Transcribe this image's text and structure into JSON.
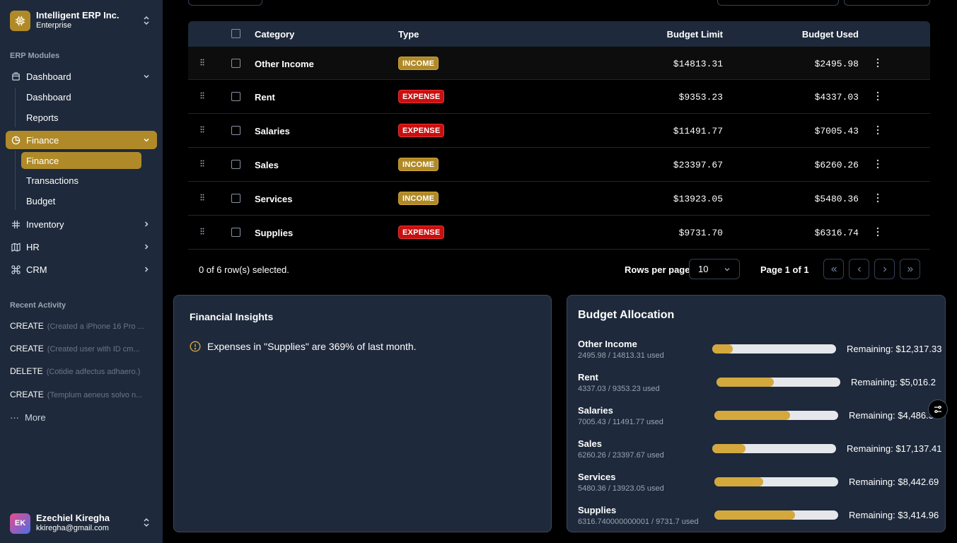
{
  "org": {
    "name": "Intelligent ERP Inc.",
    "plan": "Enterprise"
  },
  "sidebar": {
    "section_label": "ERP Modules",
    "dashboard": {
      "label": "Dashboard",
      "subitems": [
        "Dashboard",
        "Reports"
      ]
    },
    "finance": {
      "label": "Finance",
      "subitems": [
        "Finance",
        "Transactions",
        "Budget"
      ]
    },
    "inventory": {
      "label": "Inventory"
    },
    "hr": {
      "label": "HR"
    },
    "crm": {
      "label": "CRM"
    },
    "recent_label": "Recent Activity",
    "recent": [
      {
        "action": "CREATE",
        "desc": "(Created a iPhone 16 Pro ..."
      },
      {
        "action": "CREATE",
        "desc": "(Created user with ID cm..."
      },
      {
        "action": "DELETE",
        "desc": "(Cotidie adfectus adhaero.)"
      },
      {
        "action": "CREATE",
        "desc": "(Templum aeneus solvo n..."
      }
    ],
    "more_label": "More"
  },
  "user": {
    "name": "Ezechiel Kiregha",
    "email": "kkiregha@gmail.com",
    "initials": "EK"
  },
  "table": {
    "headers": {
      "category": "Category",
      "type": "Type",
      "limit": "Budget Limit",
      "used": "Budget Used"
    },
    "rows": [
      {
        "category": "Other Income",
        "type": "INCOME",
        "limit": "$14813.31",
        "used": "$2495.98"
      },
      {
        "category": "Rent",
        "type": "EXPENSE",
        "limit": "$9353.23",
        "used": "$4337.03"
      },
      {
        "category": "Salaries",
        "type": "EXPENSE",
        "limit": "$11491.77",
        "used": "$7005.43"
      },
      {
        "category": "Sales",
        "type": "INCOME",
        "limit": "$23397.67",
        "used": "$6260.26"
      },
      {
        "category": "Services",
        "type": "INCOME",
        "limit": "$13923.05",
        "used": "$5480.36"
      },
      {
        "category": "Supplies",
        "type": "EXPENSE",
        "limit": "$9731.70",
        "used": "$6316.74"
      }
    ]
  },
  "pagination": {
    "selected_text": "0 of 6 row(s) selected.",
    "rows_per_page_label": "Rows per page",
    "rows_per_page_value": "10",
    "page_text": "Page 1 of 1"
  },
  "insights": {
    "title": "Financial Insights",
    "message": "Expenses in \"Supplies\" are 369% of last month."
  },
  "allocation": {
    "title": "Budget Allocation",
    "items": [
      {
        "name": "Other Income",
        "detail": "2495.98 / 14813.31 used",
        "remaining": "Remaining: $12,317.33",
        "fraction": 0.1685
      },
      {
        "name": "Rent",
        "detail": "4337.03 / 9353.23 used",
        "remaining": "Remaining: $5,016.2",
        "fraction": 0.4637
      },
      {
        "name": "Salaries",
        "detail": "7005.43 / 11491.77 used",
        "remaining": "Remaining: $4,486.3",
        "fraction": 0.6096
      },
      {
        "name": "Sales",
        "detail": "6260.26 / 23397.67 used",
        "remaining": "Remaining: $17,137.41",
        "fraction": 0.2676
      },
      {
        "name": "Services",
        "detail": "5480.36 / 13923.05 used",
        "remaining": "Remaining: $8,442.69",
        "fraction": 0.3936
      },
      {
        "name": "Supplies",
        "detail": "6316.740000000001 / 9731.7 used",
        "remaining": "Remaining: $3,414.96",
        "fraction": 0.6491
      }
    ]
  }
}
